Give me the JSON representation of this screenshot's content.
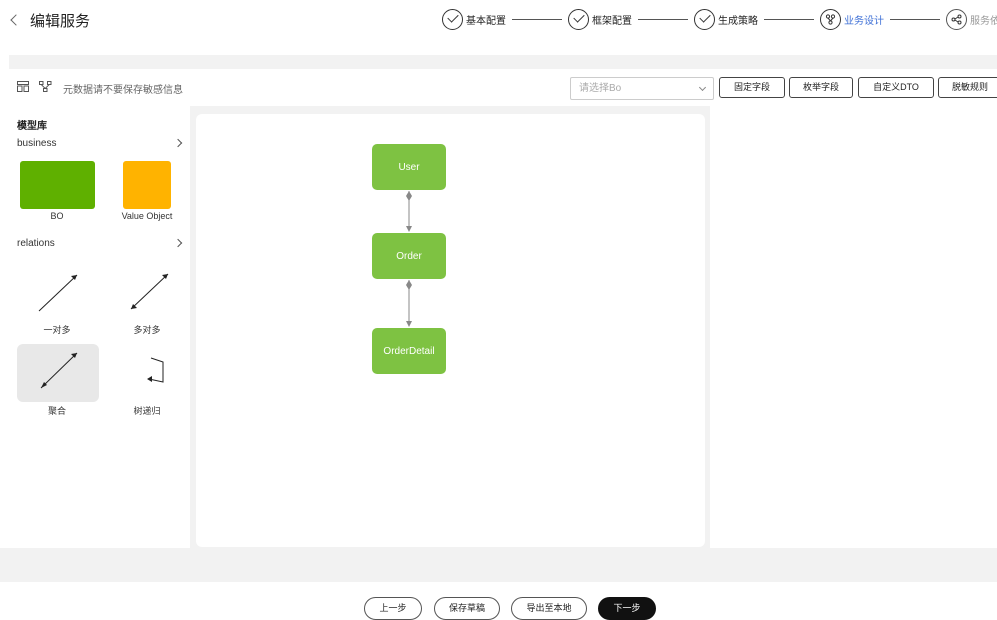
{
  "header": {
    "title": "编辑服务",
    "steps": [
      {
        "label": "基本配置",
        "state": "done"
      },
      {
        "label": "框架配置",
        "state": "done"
      },
      {
        "label": "生成策略",
        "state": "done"
      },
      {
        "label": "业务设计",
        "state": "active"
      },
      {
        "label": "服务依赖",
        "state": "pending"
      }
    ]
  },
  "toolbar": {
    "hint": "元数据请不要保存敏感信息",
    "select_placeholder": "请选择Bo",
    "buttons": [
      "固定字段",
      "枚举字段",
      "自定义DTO",
      "脱敏规则"
    ]
  },
  "library": {
    "title": "模型库",
    "business_label": "business",
    "business_items": [
      {
        "label": "BO",
        "color": "#5fb000"
      },
      {
        "label": "Value Object",
        "color": "#ffb300"
      }
    ],
    "relations_label": "relations",
    "relation_items": [
      {
        "label": "一对多"
      },
      {
        "label": "多对多"
      },
      {
        "label": "聚合"
      },
      {
        "label": "树递归"
      }
    ]
  },
  "canvas": {
    "nodes": [
      "User",
      "Order",
      "OrderDetail"
    ],
    "node_color": "#7ec242"
  },
  "footer": {
    "prev": "上一步",
    "save_draft": "保存草稿",
    "export": "导出至本地",
    "next": "下一步"
  }
}
